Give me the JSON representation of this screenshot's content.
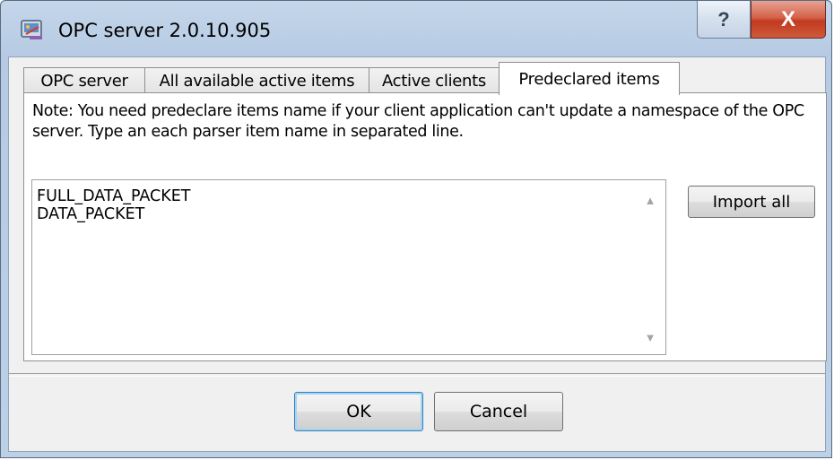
{
  "window": {
    "title": "OPC server 2.0.10.905",
    "help_glyph": "?",
    "close_glyph": "X",
    "icon": "app-icon"
  },
  "tabs": [
    {
      "label": "OPC server",
      "active": false
    },
    {
      "label": "All available active items",
      "active": false
    },
    {
      "label": "Active clients",
      "active": false
    },
    {
      "label": "Predeclared items",
      "active": true
    }
  ],
  "panel": {
    "note": "Note: You need predeclare items name if your client application can't update a namespace of the OPC server. Type an each parser item name in separated line.",
    "items": [
      "FULL_DATA_PACKET",
      "DATA_PACKET"
    ],
    "import_label": "Import all"
  },
  "footer": {
    "ok_label": "OK",
    "cancel_label": "Cancel"
  },
  "icons": {
    "scroll_up": "scroll-up-arrow-icon",
    "scroll_down": "scroll-down-arrow-icon"
  }
}
